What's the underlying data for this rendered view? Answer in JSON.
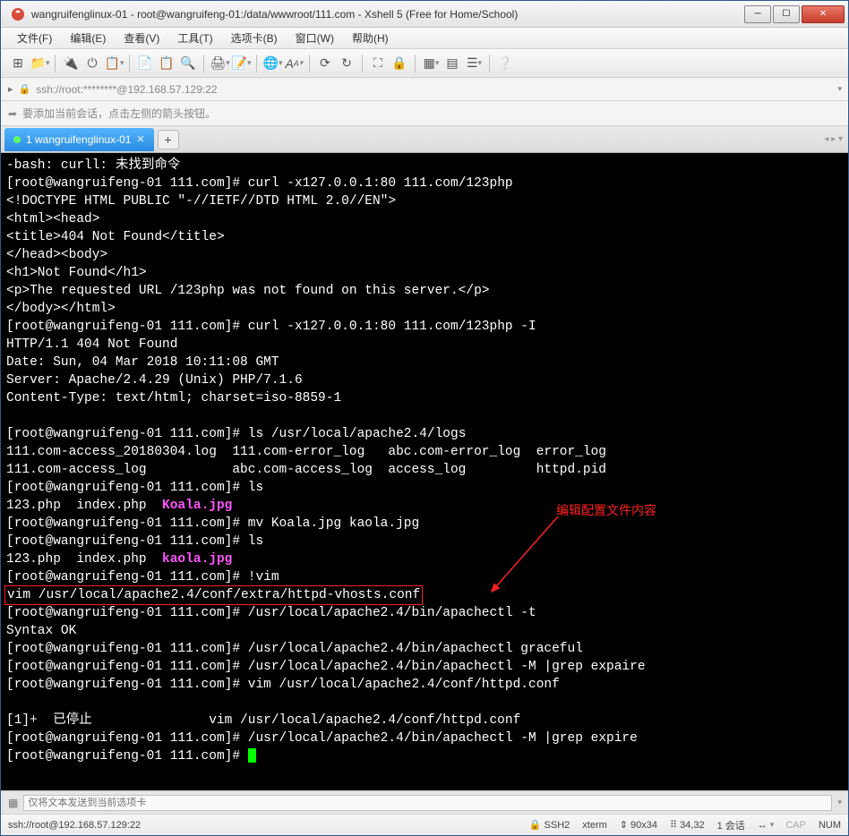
{
  "window": {
    "title": "wangruifenglinux-01 - root@wangruifeng-01:/data/wwwroot/111.com - Xshell 5 (Free for Home/School)"
  },
  "menu": {
    "file": "文件(F)",
    "edit": "编辑(E)",
    "view": "查看(V)",
    "tools": "工具(T)",
    "tabs": "选项卡(B)",
    "window": "窗口(W)",
    "help": "帮助(H)"
  },
  "address": "ssh://root:********@192.168.57.129:22",
  "hint": "要添加当前会话，点击左侧的箭头按钮。",
  "tab": {
    "label": "1 wangruifenglinux-01"
  },
  "annotation": "编辑配置文件内容",
  "term": {
    "l1": "-bash: curll: 未找到命令",
    "l2a": "[root@wangruifeng-01 111.com]# ",
    "l2b": "curl -x127.0.0.1:80 111.com/123php",
    "l3": "<!DOCTYPE HTML PUBLIC \"-//IETF//DTD HTML 2.0//EN\">",
    "l4": "<html><head>",
    "l5": "<title>404 Not Found</title>",
    "l6": "</head><body>",
    "l7": "<h1>Not Found</h1>",
    "l8": "<p>The requested URL /123php was not found on this server.</p>",
    "l9": "</body></html>",
    "l10b": "curl -x127.0.0.1:80 111.com/123php -I",
    "l11": "HTTP/1.1 404 Not Found",
    "l12": "Date: Sun, 04 Mar 2018 10:11:08 GMT",
    "l13": "Server: Apache/2.4.29 (Unix) PHP/7.1.6",
    "l14": "Content-Type: text/html; charset=iso-8859-1",
    "l16b": "ls /usr/local/apache2.4/logs",
    "l17": "111.com-access_20180304.log  111.com-error_log   abc.com-error_log  error_log",
    "l18": "111.com-access_log           abc.com-access_log  access_log         httpd.pid",
    "l19b": "ls",
    "l20a": "123.php  index.php  ",
    "l20b": "Koala.jpg",
    "l21b": "mv Koala.jpg kaola.jpg",
    "l22b": "ls",
    "l23a": "123.php  index.php  ",
    "l23b": "kaola.jpg",
    "l24b": "!vim",
    "l25": "vim /usr/local/apache2.4/conf/extra/httpd-vhosts.conf",
    "l26b": "/usr/local/apache2.4/bin/apachectl -t",
    "l27": "Syntax OK",
    "l28b": "/usr/local/apache2.4/bin/apachectl graceful",
    "l29b": "/usr/local/apache2.4/bin/apachectl -M |grep expaire",
    "l30b": "vim /usr/local/apache2.4/conf/httpd.conf",
    "l32": "[1]+  已停止               vim /usr/local/apache2.4/conf/httpd.conf",
    "l33b": "/usr/local/apache2.4/bin/apachectl -M |grep expire"
  },
  "footer_placeholder": "仅将文本发送到当前选项卡",
  "status": {
    "conn": "ssh://root@192.168.57.129:22",
    "proto": "SSH2",
    "term": "xterm",
    "size": "90x34",
    "pos": "34,32",
    "sess": "1 会话",
    "cap": "CAP",
    "num": "NUM"
  }
}
